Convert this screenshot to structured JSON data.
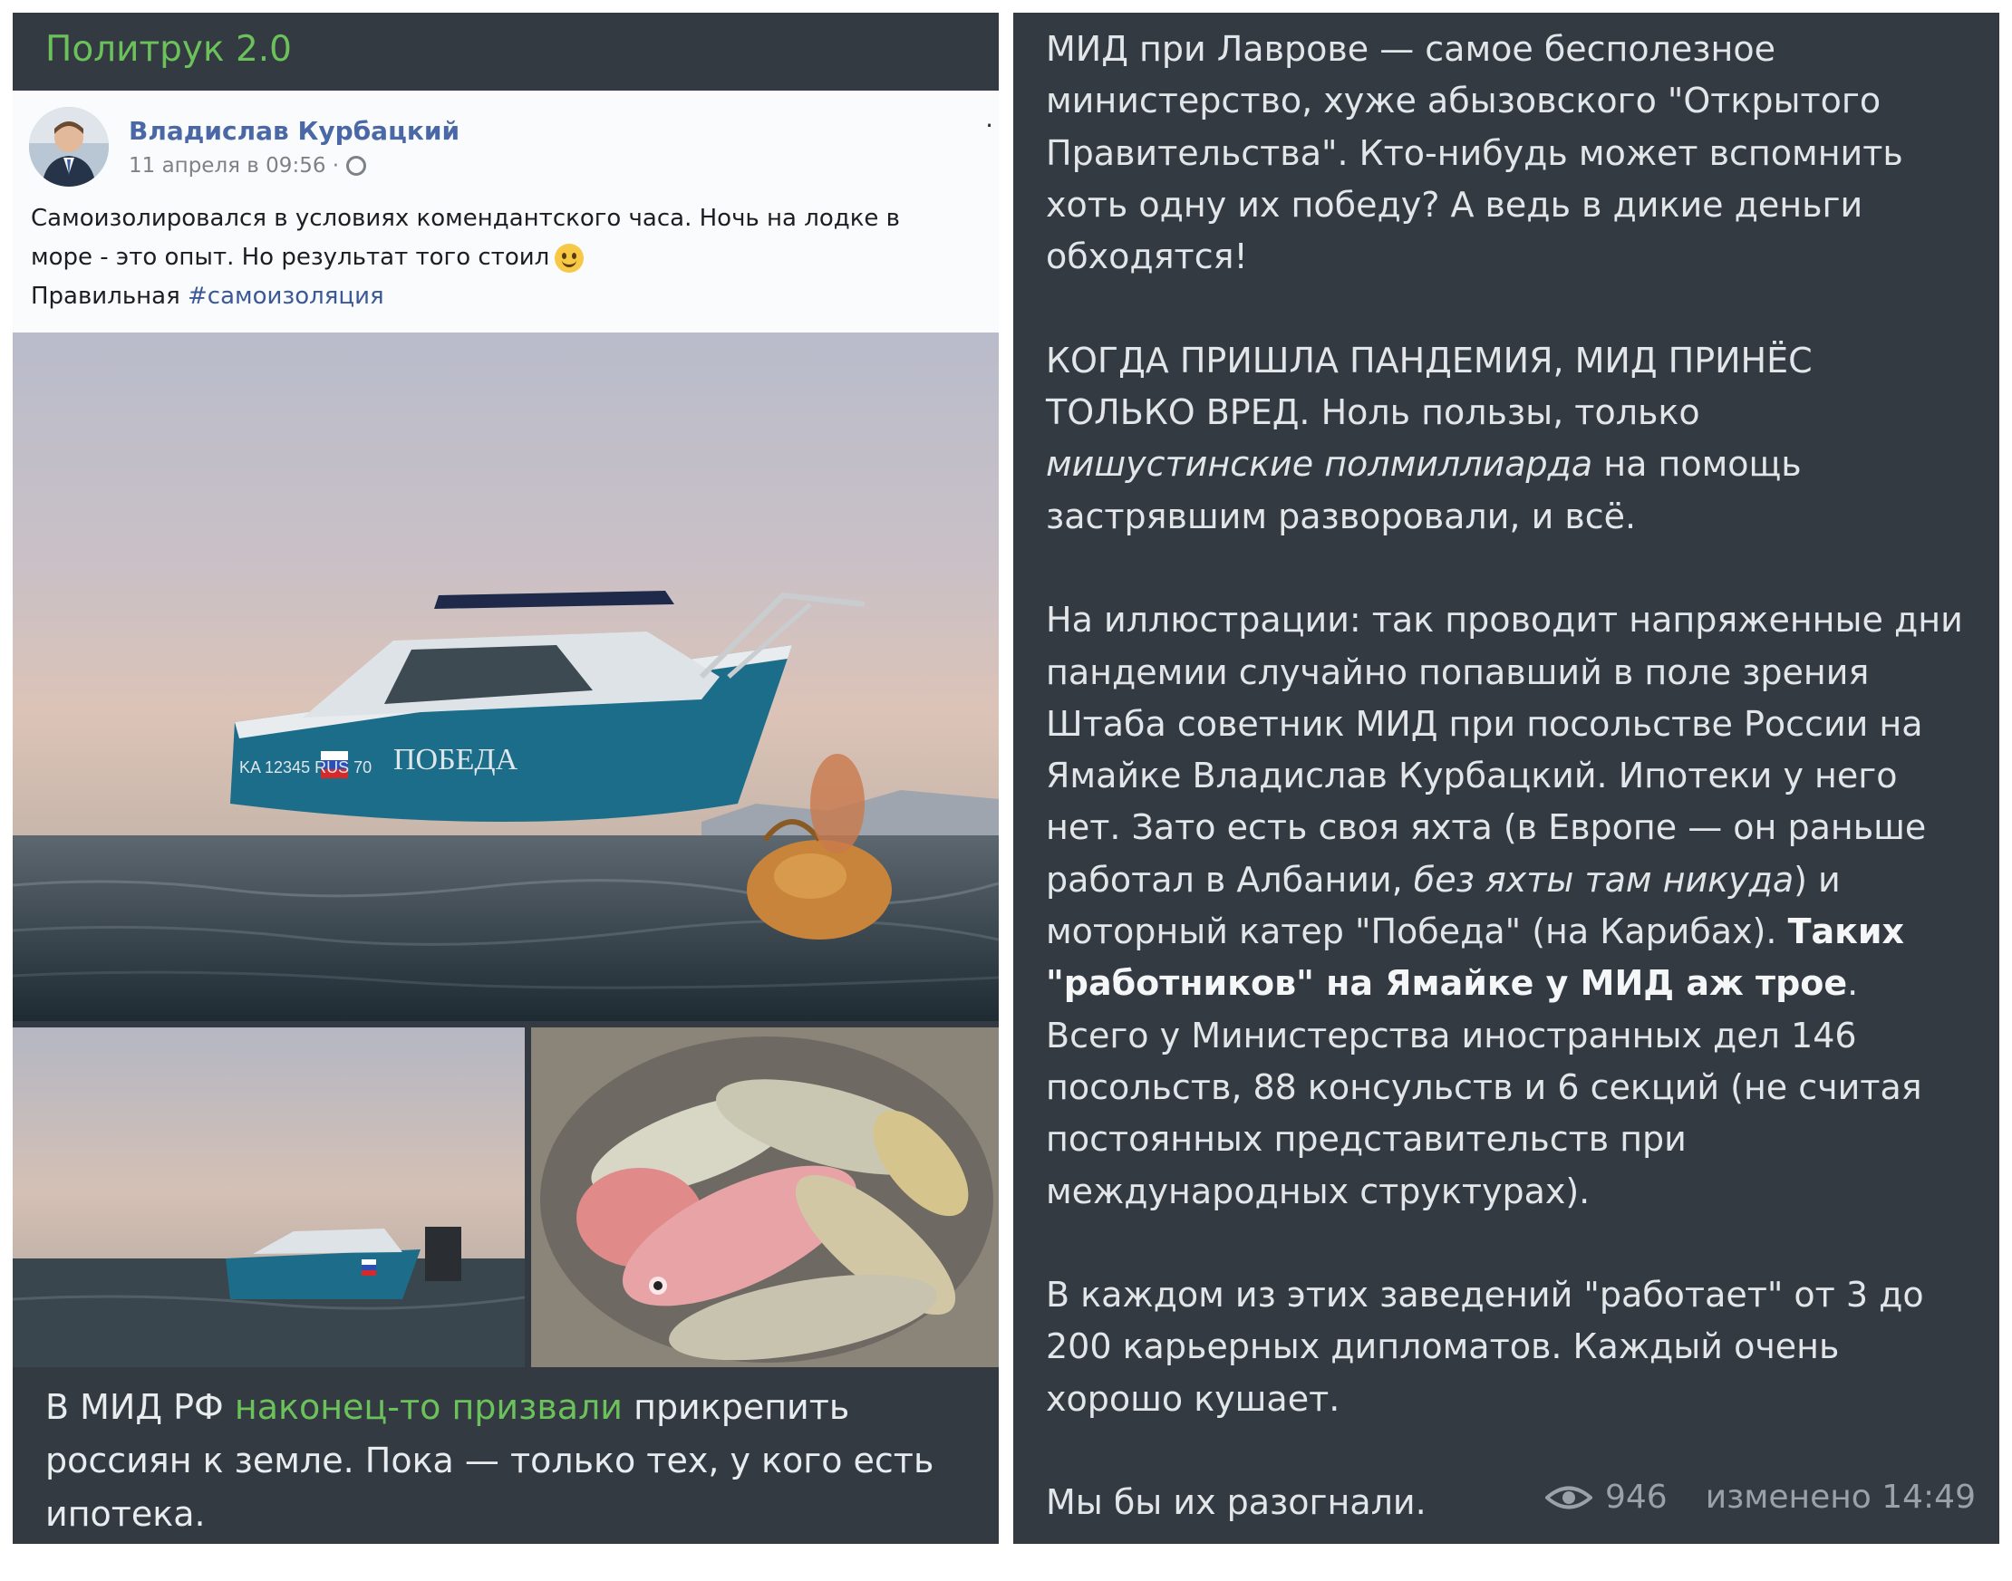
{
  "left_post": {
    "channel_title": "Политрук 2.0",
    "fb": {
      "author": "Владислав Курбацкий",
      "timestamp": "11 апреля в 09:56 ·",
      "text_line1": "Самоизолировался в условиях комендантского часа. Ночь на лодке в",
      "text_line2": "море - это опыт. Но результат того стоил",
      "text_line3_prefix": "Правильная",
      "hashtag": "#самоизоляция"
    },
    "boat_name": "ПОБЕДА",
    "boat_reg": "KA 12345 RUS 70",
    "caption_prefix": "В МИД РФ",
    "caption_link": "наконец-то призвали",
    "caption_suffix": "прикрепить россиян к земле. Пока — только тех, у кого есть ипотека."
  },
  "right_post": {
    "p1": "МИД при Лаврове — самое бесполезное министерство, хуже абызовского \"Открытого Правительства\". Кто-нибудь может вспомнить хоть одну их победу? А ведь в дикие деньги обходятся!",
    "p2_a": "КОГДА ПРИШЛА ПАНДЕМИЯ, МИД ПРИНЁС ТОЛЬКО ВРЕД. Ноль пользы, только",
    "p2_italic": "мишустинские полмиллиарда",
    "p2_b": "на помощь застрявшим разворовали, и всё.",
    "p3_a": "На иллюстрации: так проводит напряженные дни пандемии случайно попавший в поле зрения Штаба советник МИД при посольстве России на Ямайке Владислав Курбацкий. Ипотеки у него нет. Зато есть своя яхта (в Европе — он раньше работал в Албании,",
    "p3_italic": "без яхты там никуда",
    "p3_b": ") и моторный катер \"Победа\" (на Карибах).",
    "p3_bold": "Таких \"работников\" на Ямайке у МИД аж трое",
    "p3_c": ". Всего у Министерства иностранных дел 146 посольств, 88 консульств и 6 секций (не считая постоянных представительств при международных структурах).",
    "p4": "В каждом из этих заведений \"работает\" от 3 до 200 карьерных дипломатов. Каждый очень хорошо кушает.",
    "p5": "Мы бы их разогнали.",
    "views": "946",
    "edited": "изменено 14:49"
  }
}
